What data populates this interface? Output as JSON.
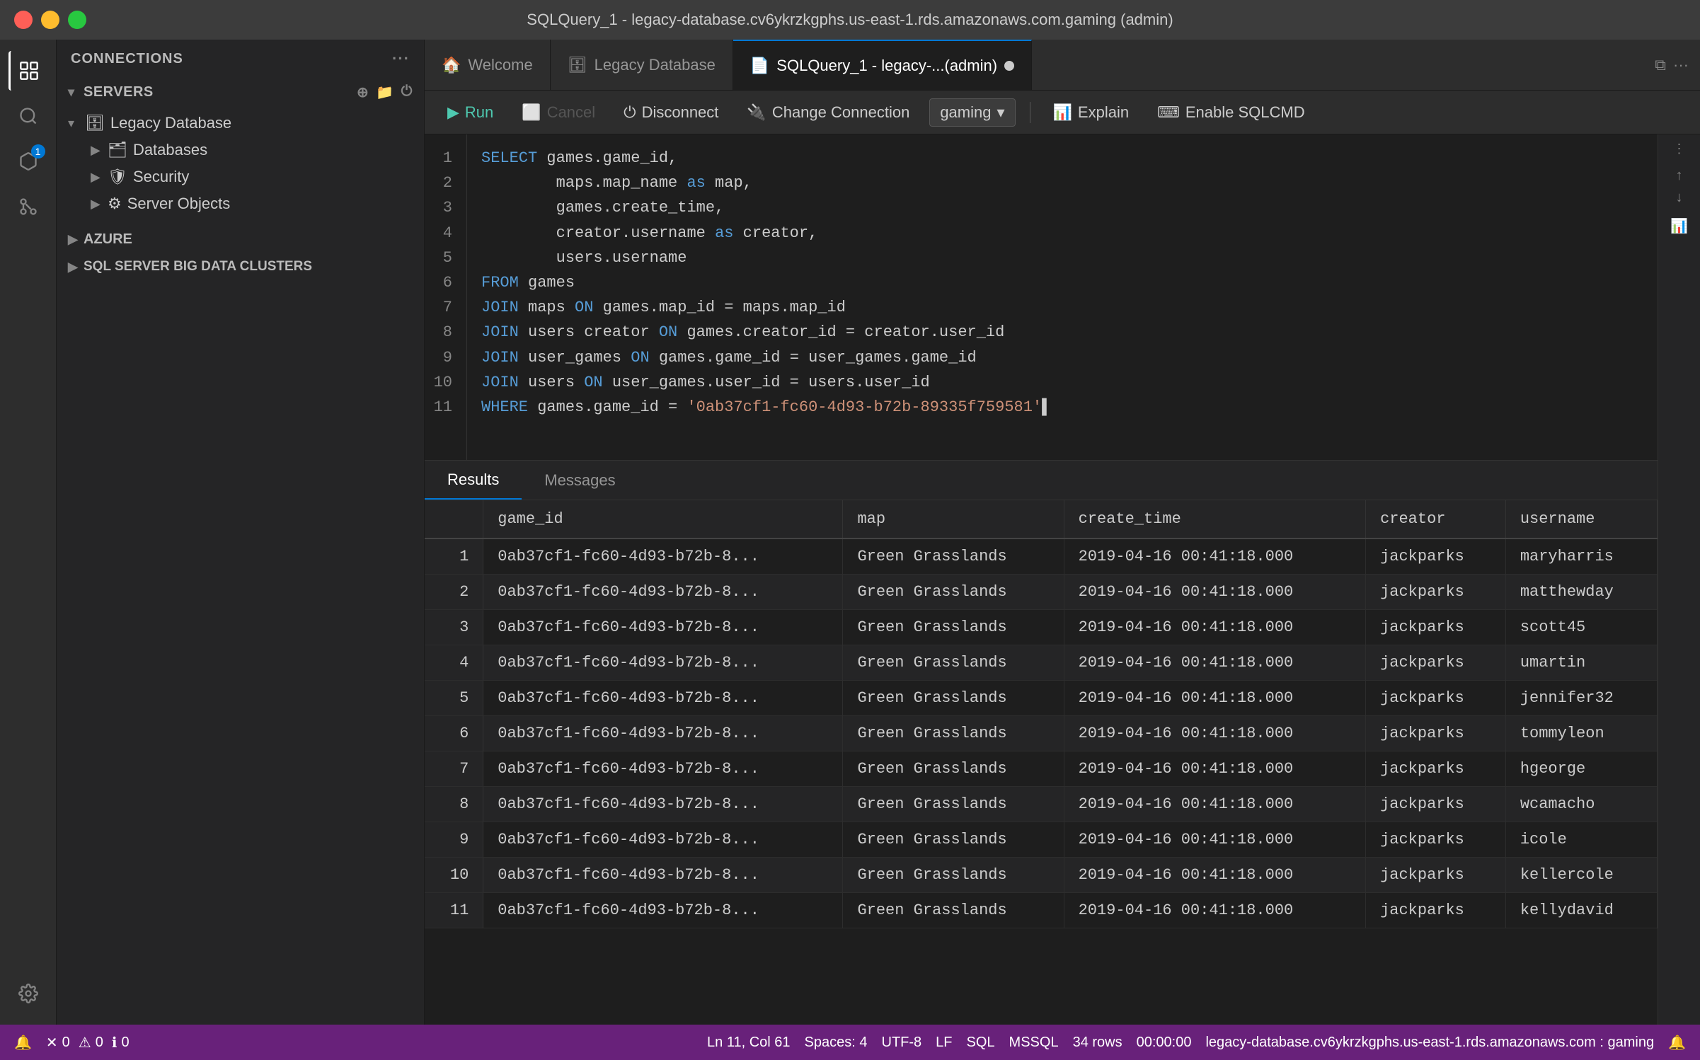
{
  "window": {
    "title": "SQLQuery_1 - legacy-database.cv6ykrzkgphs.us-east-1.rds.amazonaws.com.gaming (admin)"
  },
  "tabs": {
    "items": [
      {
        "id": "welcome",
        "label": "Welcome",
        "icon": "🏠",
        "active": false
      },
      {
        "id": "legacy",
        "label": "Legacy Database",
        "icon": "🗄",
        "active": false
      },
      {
        "id": "query",
        "label": "SQLQuery_1 - legacy-...(admin)",
        "icon": "📄",
        "active": true,
        "unsaved": true
      }
    ]
  },
  "toolbar": {
    "run_label": "Run",
    "cancel_label": "Cancel",
    "disconnect_label": "Disconnect",
    "change_connection_label": "Change Connection",
    "explain_label": "Explain",
    "enable_sqlcmd_label": "Enable SQLCMD",
    "connection": "gaming"
  },
  "sidebar": {
    "header": "CONNECTIONS",
    "servers_label": "SERVERS",
    "tree": {
      "legacy_db": "Legacy Database",
      "databases": "Databases",
      "security": "Security",
      "server_objects": "Server Objects"
    },
    "azure_label": "AZURE",
    "sql_big_data_label": "SQL SERVER BIG DATA CLUSTERS"
  },
  "editor": {
    "lines": [
      {
        "num": 1,
        "code": "SELECT games.game_id,",
        "tokens": [
          {
            "t": "kw",
            "v": "SELECT"
          },
          {
            "t": "plain",
            "v": " games.game_id,"
          }
        ]
      },
      {
        "num": 2,
        "code": "        maps.map_name as map,",
        "tokens": [
          {
            "t": "plain",
            "v": "        maps.map_name "
          },
          {
            "t": "kw",
            "v": "as"
          },
          {
            "t": "plain",
            "v": " map,"
          }
        ]
      },
      {
        "num": 3,
        "code": "        games.create_time,",
        "tokens": [
          {
            "t": "plain",
            "v": "        games.create_time,"
          }
        ]
      },
      {
        "num": 4,
        "code": "        creator.username as creator,",
        "tokens": [
          {
            "t": "plain",
            "v": "        creator.username "
          },
          {
            "t": "kw",
            "v": "as"
          },
          {
            "t": "plain",
            "v": " creator,"
          }
        ]
      },
      {
        "num": 5,
        "code": "        users.username",
        "tokens": [
          {
            "t": "plain",
            "v": "        users.username"
          }
        ]
      },
      {
        "num": 6,
        "code": "FROM games",
        "tokens": [
          {
            "t": "kw",
            "v": "FROM"
          },
          {
            "t": "plain",
            "v": " games"
          }
        ]
      },
      {
        "num": 7,
        "code": "JOIN maps ON games.map_id = maps.map_id",
        "tokens": [
          {
            "t": "kw",
            "v": "JOIN"
          },
          {
            "t": "plain",
            "v": " maps "
          },
          {
            "t": "kw",
            "v": "ON"
          },
          {
            "t": "plain",
            "v": " games.map_id = maps.map_id"
          }
        ]
      },
      {
        "num": 8,
        "code": "JOIN users creator ON games.creator_id = creator.user_id",
        "tokens": [
          {
            "t": "kw",
            "v": "JOIN"
          },
          {
            "t": "plain",
            "v": " users creator "
          },
          {
            "t": "kw",
            "v": "ON"
          },
          {
            "t": "plain",
            "v": " games.creator_id = creator.user_id"
          }
        ]
      },
      {
        "num": 9,
        "code": "JOIN user_games ON games.game_id = user_games.game_id",
        "tokens": [
          {
            "t": "kw",
            "v": "JOIN"
          },
          {
            "t": "plain",
            "v": " user_games "
          },
          {
            "t": "kw",
            "v": "ON"
          },
          {
            "t": "plain",
            "v": " games.game_id = user_games.game_id"
          }
        ]
      },
      {
        "num": 10,
        "code": "JOIN users ON user_games.user_id = users.user_id",
        "tokens": [
          {
            "t": "kw",
            "v": "JOIN"
          },
          {
            "t": "plain",
            "v": " users "
          },
          {
            "t": "kw",
            "v": "ON"
          },
          {
            "t": "plain",
            "v": " user_games.user_id = users.user_id"
          }
        ]
      },
      {
        "num": 11,
        "code": "WHERE games.game_id = '0ab37cf1-fc60-4d93-b72b-89335f759581'",
        "tokens": [
          {
            "t": "kw",
            "v": "WHERE"
          },
          {
            "t": "plain",
            "v": " games.game_id = "
          },
          {
            "t": "str",
            "v": "'0ab37cf1-fc60-4d93-b72b-89335f759581'"
          }
        ],
        "cursor": true
      }
    ]
  },
  "results": {
    "tabs": [
      {
        "id": "results",
        "label": "Results",
        "active": true
      },
      {
        "id": "messages",
        "label": "Messages",
        "active": false
      }
    ],
    "columns": [
      "",
      "game_id",
      "map",
      "create_time",
      "creator",
      "username"
    ],
    "rows": [
      {
        "num": 1,
        "game_id": "0ab37cf1-fc60-4d93-b72b-8...",
        "map": "Green Grasslands",
        "create_time": "2019-04-16 00:41:18.000",
        "creator": "jackparks",
        "username": "maryharris"
      },
      {
        "num": 2,
        "game_id": "0ab37cf1-fc60-4d93-b72b-8...",
        "map": "Green Grasslands",
        "create_time": "2019-04-16 00:41:18.000",
        "creator": "jackparks",
        "username": "matthewday"
      },
      {
        "num": 3,
        "game_id": "0ab37cf1-fc60-4d93-b72b-8...",
        "map": "Green Grasslands",
        "create_time": "2019-04-16 00:41:18.000",
        "creator": "jackparks",
        "username": "scott45"
      },
      {
        "num": 4,
        "game_id": "0ab37cf1-fc60-4d93-b72b-8...",
        "map": "Green Grasslands",
        "create_time": "2019-04-16 00:41:18.000",
        "creator": "jackparks",
        "username": "umartin"
      },
      {
        "num": 5,
        "game_id": "0ab37cf1-fc60-4d93-b72b-8...",
        "map": "Green Grasslands",
        "create_time": "2019-04-16 00:41:18.000",
        "creator": "jackparks",
        "username": "jennifer32"
      },
      {
        "num": 6,
        "game_id": "0ab37cf1-fc60-4d93-b72b-8...",
        "map": "Green Grasslands",
        "create_time": "2019-04-16 00:41:18.000",
        "creator": "jackparks",
        "username": "tommyleon"
      },
      {
        "num": 7,
        "game_id": "0ab37cf1-fc60-4d93-b72b-8...",
        "map": "Green Grasslands",
        "create_time": "2019-04-16 00:41:18.000",
        "creator": "jackparks",
        "username": "hgeorge"
      },
      {
        "num": 8,
        "game_id": "0ab37cf1-fc60-4d93-b72b-8...",
        "map": "Green Grasslands",
        "create_time": "2019-04-16 00:41:18.000",
        "creator": "jackparks",
        "username": "wcamacho"
      },
      {
        "num": 9,
        "game_id": "0ab37cf1-fc60-4d93-b72b-8...",
        "map": "Green Grasslands",
        "create_time": "2019-04-16 00:41:18.000",
        "creator": "jackparks",
        "username": "icole"
      },
      {
        "num": 10,
        "game_id": "0ab37cf1-fc60-4d93-b72b-8...",
        "map": "Green Grasslands",
        "create_time": "2019-04-16 00:41:18.000",
        "creator": "jackparks",
        "username": "kellercole"
      },
      {
        "num": 11,
        "game_id": "0ab37cf1-fc60-4d93-b72b-8...",
        "map": "Green Grasslands",
        "create_time": "2019-04-16 00:41:18.000",
        "creator": "jackparks",
        "username": "kellydavid"
      }
    ]
  },
  "status_bar": {
    "bell_icon": "🔔",
    "error_count": "0",
    "warning_count": "0",
    "info_count": "0",
    "line": "Ln 11, Col 61",
    "spaces": "Spaces: 4",
    "encoding": "UTF-8",
    "line_ending": "LF",
    "language": "SQL",
    "dialect": "MSSQL",
    "rows": "34 rows",
    "time": "00:00:00",
    "server": "legacy-database.cv6ykrzkgphs.us-east-1.rds.amazonaws.com : gaming",
    "notification_icon": "🔔"
  }
}
